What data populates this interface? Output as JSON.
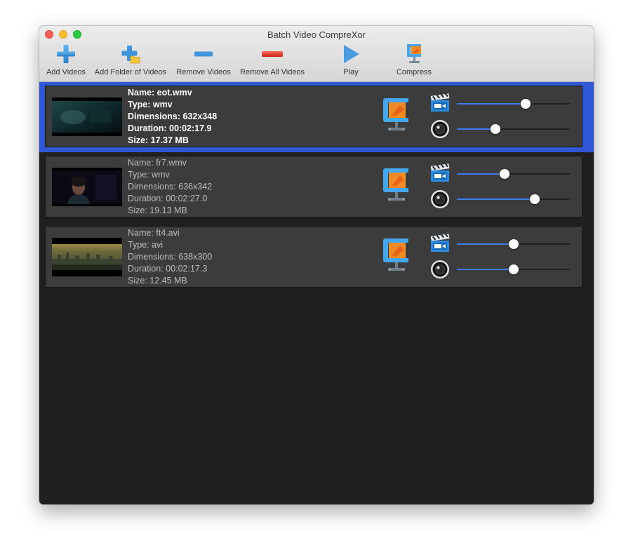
{
  "window": {
    "title": "Batch Video CompreXor"
  },
  "toolbar": [
    {
      "label": "Add Videos",
      "icon": "add-plus-icon"
    },
    {
      "label": "Add Folder of Videos",
      "icon": "add-folder-icon"
    },
    {
      "label": "Remove Videos",
      "icon": "minus-icon"
    },
    {
      "label": "Remove All Videos",
      "icon": "remove-all-icon"
    },
    {
      "label": "Play",
      "icon": "play-icon"
    },
    {
      "label": "Compress",
      "icon": "compress-clamp-icon"
    }
  ],
  "videos": [
    {
      "name": "Name: eot.wmv",
      "type": "Type: wmv",
      "dimensions": "Dimensions: 632x348",
      "duration": "Duration:  00:02:17.9",
      "size": "Size: 17.37 MB",
      "selected": true,
      "video_quality": 0.61,
      "audio_quality": 0.34
    },
    {
      "name": "Name: fr7.wmv",
      "type": "Type: wmv",
      "dimensions": "Dimensions: 636x342",
      "duration": "Duration:  00:02:27.0",
      "size": "Size: 19.13 MB",
      "selected": false,
      "video_quality": 0.42,
      "audio_quality": 0.69
    },
    {
      "name": "Name: ft4.avi",
      "type": "Type: avi",
      "dimensions": "Dimensions: 638x300",
      "duration": "Duration:  00:02:17.3",
      "size": "Size: 12.45 MB",
      "selected": false,
      "video_quality": 0.5,
      "audio_quality": 0.5
    }
  ],
  "colors": {
    "selection": "#2f57d6",
    "slider_fill": "#3f7bf0",
    "row_background": "#3c3c3c",
    "list_background": "#1f1f1f"
  }
}
